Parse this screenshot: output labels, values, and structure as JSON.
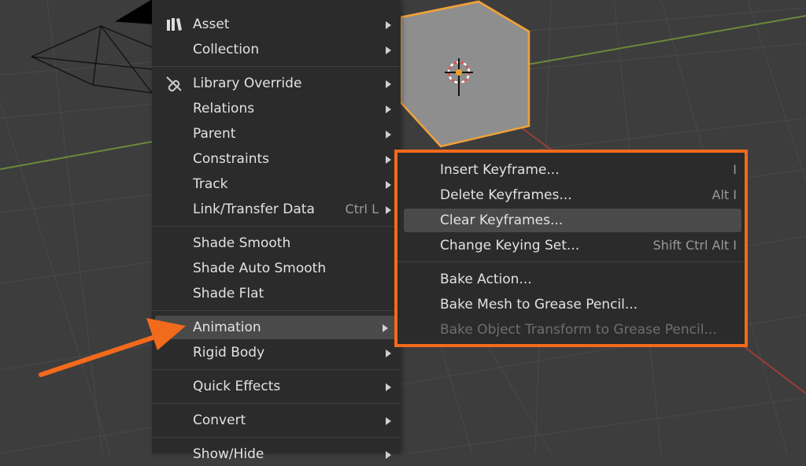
{
  "colors": {
    "accent": "#f26a1b",
    "menu_bg": "#2b2b2b",
    "viewport_bg": "#3d3d3d",
    "selection_outline": "#f0a13a"
  },
  "object_menu": {
    "items": [
      {
        "label": "Asset",
        "icon": "asset-icon",
        "submenu": true
      },
      {
        "label": "Collection",
        "submenu": true
      },
      {
        "label": "Library Override",
        "icon": "library-override-icon",
        "submenu": true
      },
      {
        "label": "Relations",
        "submenu": true
      },
      {
        "label": "Parent",
        "submenu": true
      },
      {
        "label": "Constraints",
        "submenu": true
      },
      {
        "label": "Track",
        "submenu": true
      },
      {
        "label": "Link/Transfer Data",
        "shortcut": "Ctrl L",
        "submenu": true
      },
      {
        "label": "Shade Smooth"
      },
      {
        "label": "Shade Auto Smooth"
      },
      {
        "label": "Shade Flat"
      },
      {
        "label": "Animation",
        "submenu": true,
        "highlighted": true
      },
      {
        "label": "Rigid Body",
        "submenu": true
      },
      {
        "label": "Quick Effects",
        "submenu": true
      },
      {
        "label": "Convert",
        "submenu": true
      },
      {
        "label": "Show/Hide",
        "submenu": true
      }
    ]
  },
  "animation_submenu": {
    "items": [
      {
        "label": "Insert Keyframe...",
        "shortcut": "I"
      },
      {
        "label": "Delete Keyframes...",
        "shortcut": "Alt I"
      },
      {
        "label": "Clear Keyframes...",
        "highlighted": true
      },
      {
        "label": "Change Keying Set...",
        "shortcut": "Shift Ctrl Alt I"
      },
      {
        "label": "Bake Action..."
      },
      {
        "label": "Bake Mesh to Grease Pencil..."
      },
      {
        "label": "Bake Object Transform to Grease Pencil...",
        "disabled": true
      }
    ]
  }
}
